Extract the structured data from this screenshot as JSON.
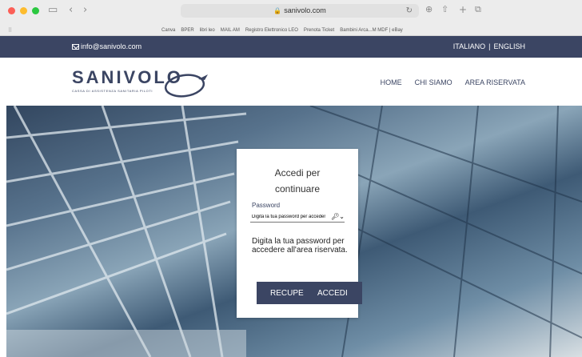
{
  "browser": {
    "url": "sanivolo.com",
    "bookmarks": [
      "Canva",
      "BPER",
      "libri leo",
      "MAIL AM",
      "Registro Elettronico LEO",
      "Prenota Ticket",
      "Bambini Arca...M MDF | eBay"
    ]
  },
  "topbar": {
    "email": "info@sanivolo.com",
    "lang_it": "ITALIANO",
    "separator": "|",
    "lang_en": "ENGLISH"
  },
  "header": {
    "logo": "SANIVOLO",
    "logo_sub": "CASSA DI ASSISTENZA SANITARIA PILOTI",
    "nav": [
      "HOME",
      "CHI SIAMO",
      "AREA RISERVATA"
    ]
  },
  "login": {
    "title_line1": "Accedi per",
    "title_line2": "continuare",
    "password_label": "Password",
    "password_placeholder": "Digita la tua password per accedere",
    "help_text": "Digita la tua password per accedere all'area riservata.",
    "recover_label": "RECUPE",
    "login_label": "ACCEDI"
  },
  "colors": {
    "brand": "#3b4563"
  }
}
